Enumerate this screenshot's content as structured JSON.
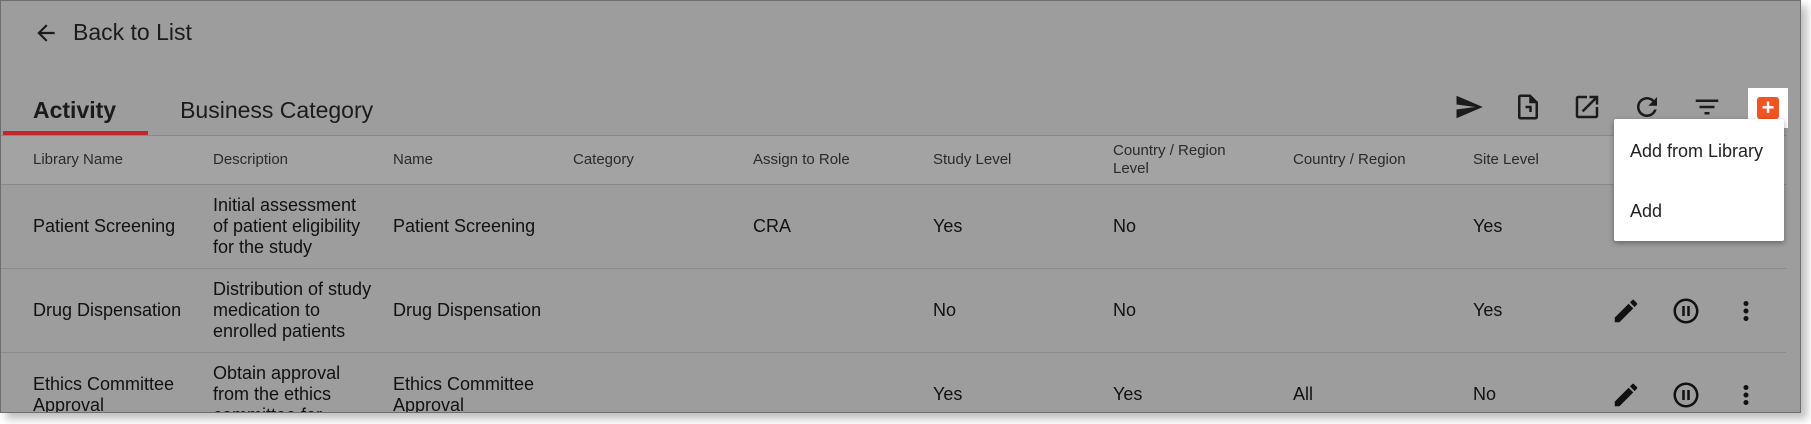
{
  "nav": {
    "back_label": "Back to List"
  },
  "tabs": [
    {
      "label": "Activity",
      "active": true
    },
    {
      "label": "Business Category",
      "active": false
    }
  ],
  "toolbar": {
    "icons": [
      "send-icon",
      "export-file-icon",
      "open-external-icon",
      "refresh-icon",
      "filter-icon",
      "add-icon"
    ]
  },
  "columns": [
    "Library Name",
    "Description",
    "Name",
    "Category",
    "Assign to Role",
    "Study Level",
    "Country / Region Level",
    "Country / Region",
    "Site Level"
  ],
  "rows": [
    {
      "library_name": "Patient Screening",
      "description": "Initial assessment of patient eligibility for the study",
      "name": "Patient Screening",
      "category": "",
      "role": "CRA",
      "study_level": "Yes",
      "country_region_level": "No",
      "country_region": "",
      "site_level": "Yes"
    },
    {
      "library_name": "Drug Dispensation",
      "description": "Distribution of study medication to enrolled patients",
      "name": "Drug Dispensation",
      "category": "",
      "role": "",
      "study_level": "No",
      "country_region_level": "No",
      "country_region": "",
      "site_level": "Yes"
    },
    {
      "library_name": "Ethics Committee Approval",
      "description": "Obtain approval from the ethics committee for",
      "name": "Ethics Committee Approval",
      "category": "",
      "role": "",
      "study_level": "Yes",
      "country_region_level": "Yes",
      "country_region": "All",
      "site_level": "No"
    }
  ],
  "add_menu": {
    "items": [
      "Add from Library",
      "Add"
    ]
  },
  "colors": {
    "accent": "#c0282d",
    "add_button": "#f05423",
    "overlay_bg": "#9d9d9d"
  }
}
